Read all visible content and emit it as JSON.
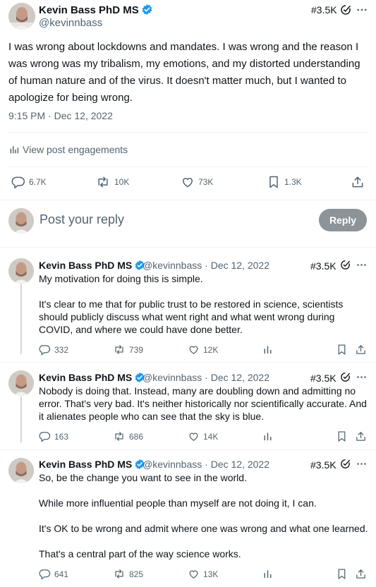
{
  "main_post": {
    "author": {
      "name": "Kevin Bass PhD MS",
      "handle": "@kevinnbass",
      "rank": "#3.5K"
    },
    "text": "I was wrong about lockdowns and mandates. I was wrong and the reason I was wrong was my tribalism, my emotions, and my distorted understanding of human nature and of the virus. It doesn't matter much, but I wanted to apologize for being wrong.",
    "timestamp": "9:15 PM · Dec 12, 2022",
    "engagements_label": "View post engagements",
    "metrics": {
      "replies": "6.7K",
      "reposts": "10K",
      "likes": "73K",
      "bookmarks": "1.3K"
    }
  },
  "composer": {
    "placeholder": "Post your reply",
    "button_label": "Reply"
  },
  "replies": [
    {
      "name": "Kevin Bass PhD MS",
      "handle": "@kevinnbass",
      "date": "· Dec 12, 2022",
      "rank": "#3.5K",
      "paragraphs": [
        "My motivation for doing this is simple.",
        "It's clear to me that for public trust to be restored in science, scientists should publicly discuss what went right and what went wrong during COVID, and where we could have done better."
      ],
      "metrics": {
        "replies": "332",
        "reposts": "739",
        "likes": "12K"
      }
    },
    {
      "name": "Kevin Bass PhD MS",
      "handle": "@kevinnbass",
      "date": "· Dec 12, 2022",
      "rank": "#3.5K",
      "paragraphs": [
        "Nobody is doing that. Instead, many are doubling down and admitting no error. That's very bad. It's neither historically nor scientifically accurate. And it alienates people who can see that the sky is blue."
      ],
      "metrics": {
        "replies": "163",
        "reposts": "686",
        "likes": "14K"
      }
    },
    {
      "name": "Kevin Bass PhD MS",
      "handle": "@kevinnbass",
      "date": "· Dec 12, 2022",
      "rank": "#3.5K",
      "paragraphs": [
        "So, be the change you want to see in the world.",
        "While more influential people than myself are not doing it, I can.",
        "It's OK to be wrong and admit where one was wrong and what one learned.",
        "That's a central part of the way science works."
      ],
      "metrics": {
        "replies": "641",
        "reposts": "825",
        "likes": "13K"
      }
    }
  ],
  "colors": {
    "text": "#0f1419",
    "secondary": "#536471",
    "verified": "#1d9bf0",
    "reply_button": "#8c9399",
    "divider": "#eff3f4",
    "thread_line": "#cfd9de"
  },
  "icons": [
    "verified-badge-icon",
    "rank-icon",
    "more-icon",
    "engagements-icon",
    "reply-icon",
    "repost-icon",
    "like-icon",
    "bookmark-icon",
    "share-icon",
    "views-icon"
  ]
}
